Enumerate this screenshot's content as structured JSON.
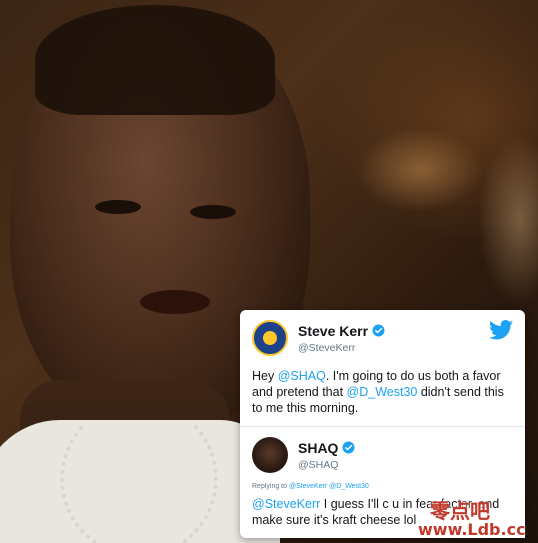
{
  "tweets": [
    {
      "name": "Steve Kerr",
      "handle": "@SteveKerr",
      "text_parts": [
        "Hey ",
        "@SHAQ",
        ". I'm going to do us both a favor and pretend that ",
        "@D_West30",
        " didn't send this to me this morning."
      ]
    },
    {
      "name": "SHAQ",
      "handle": "@SHAQ",
      "replying_prefix": "Replying to ",
      "replying_to": "@SteveKerr @D_West30",
      "text_parts": [
        "@SteveKerr",
        " I guess I'll c u in fear factor, and make sure it's kraft cheese lol"
      ]
    }
  ],
  "watermark": {
    "text": "零点吧",
    "url": "www.Ldb.cc"
  },
  "colors": {
    "accent": "#1da1f2",
    "text": "#14171a",
    "muted": "#657786",
    "watermark": "#c0392b"
  },
  "icons": [
    "verified-icon",
    "twitter-bird-icon"
  ]
}
